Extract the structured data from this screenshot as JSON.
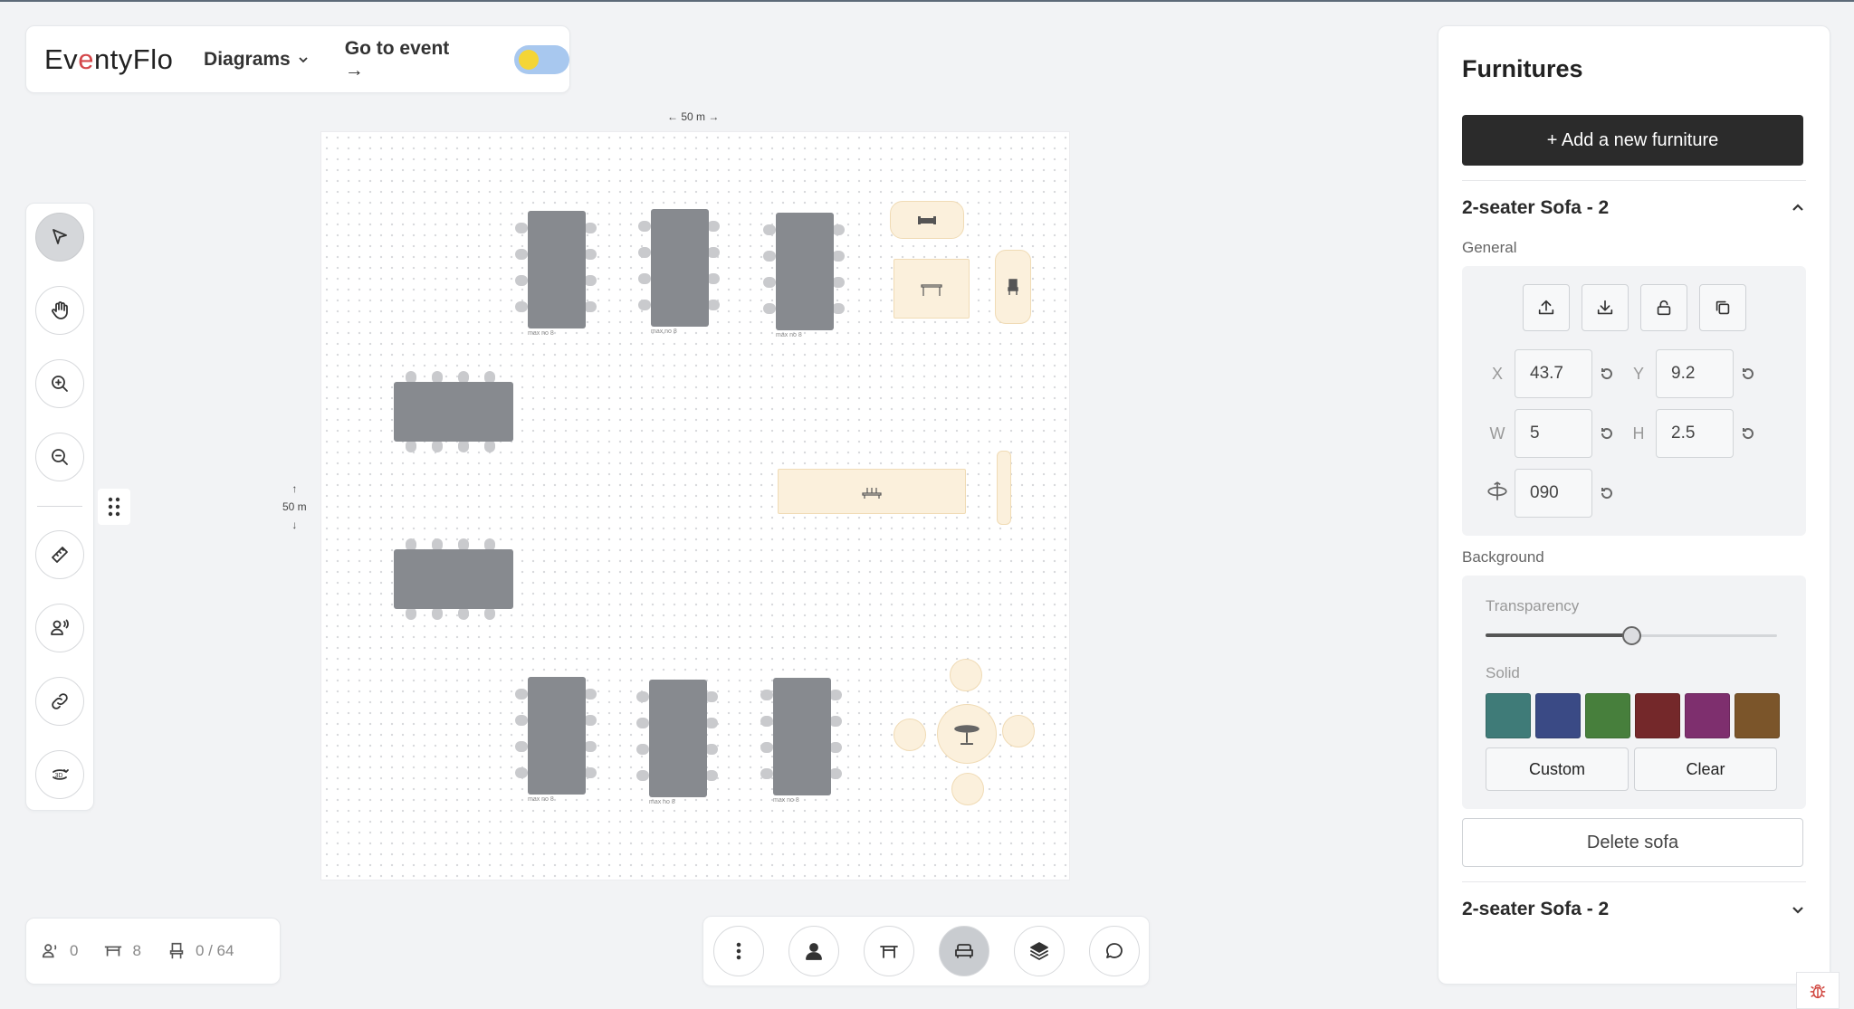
{
  "header": {
    "logo": {
      "pre": "Ev",
      "o": "e",
      "post": "ntyFlo"
    },
    "nav_diagrams": "Diagrams",
    "nav_goto": "Go to event →",
    "theme_toggle": "light"
  },
  "toolbar": {
    "tools": [
      "select-pointer",
      "pan-hand",
      "zoom-in",
      "zoom-out",
      "measure-ruler",
      "attendees",
      "link",
      "3d-view"
    ],
    "active": "select-pointer"
  },
  "canvas": {
    "width_label": "← 50 m →",
    "height_up": "↑",
    "height_label": "50 m",
    "height_down": "↓",
    "table_caption": "max no 8"
  },
  "stats": {
    "attendees": "0",
    "tables": "8",
    "seats": "0 / 64"
  },
  "bottombar": {
    "items": [
      "more-options",
      "person",
      "table",
      "sofa",
      "layers",
      "comment"
    ],
    "active": "sofa"
  },
  "panel": {
    "title": "Furnitures",
    "add_button": "+ Add a new furniture",
    "item_title": "2-seater Sofa - 2",
    "general_label": "General",
    "x_label": "X",
    "x_value": "43.7",
    "y_label": "Y",
    "y_value": "9.2",
    "w_label": "W",
    "w_value": "5",
    "h_label": "H",
    "h_value": "2.5",
    "rotation_value": "090",
    "background_label": "Background",
    "transparency_label": "Transparency",
    "transparency_level": 0.5,
    "solid_label": "Solid",
    "swatches": [
      "#3f7b78",
      "#3a4a85",
      "#477f3c",
      "#74282a",
      "#7e2f6e",
      "#7b552a"
    ],
    "custom_button": "Custom",
    "clear_button": "Clear",
    "delete_button": "Delete sofa",
    "item2_title": "2-seater Sofa - 2"
  }
}
